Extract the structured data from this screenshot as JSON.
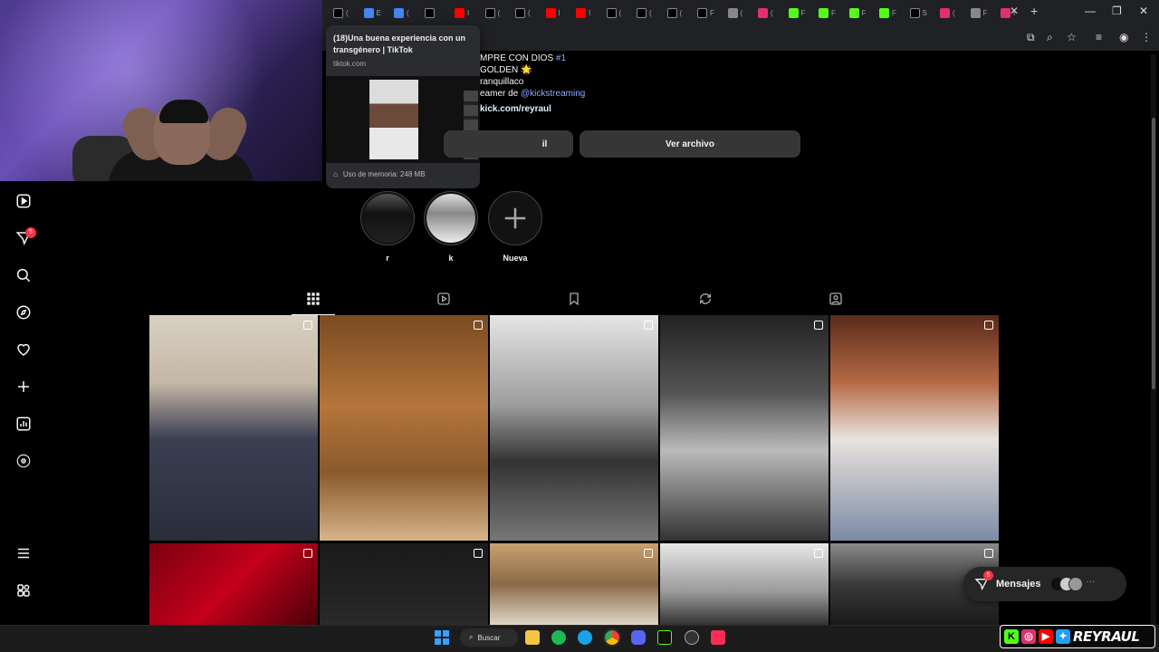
{
  "browser": {
    "tabs": [
      {
        "icon": "tiktok-icon",
        "color": "#000000",
        "label": "("
      },
      {
        "icon": "chrome-icon",
        "color": "#4285f4",
        "label": "E"
      },
      {
        "icon": "chrome-icon",
        "color": "#4285f4",
        "label": "("
      },
      {
        "icon": "tiktok-icon",
        "color": "#000000",
        "label": ""
      },
      {
        "icon": "youtube-icon",
        "color": "#ff0000",
        "label": "I"
      },
      {
        "icon": "tiktok-icon",
        "color": "#000000",
        "label": "("
      },
      {
        "icon": "tiktok-icon",
        "color": "#000000",
        "label": "("
      },
      {
        "icon": "youtube-icon",
        "color": "#ff0000",
        "label": "I"
      },
      {
        "icon": "youtube-icon",
        "color": "#ff0000",
        "label": "I"
      },
      {
        "icon": "tiktok-icon",
        "color": "#000000",
        "label": "("
      },
      {
        "icon": "tiktok-icon",
        "color": "#000000",
        "label": "("
      },
      {
        "icon": "tiktok-icon",
        "color": "#000000",
        "label": "("
      },
      {
        "icon": "tiktok-icon",
        "color": "#000000",
        "label": "F"
      },
      {
        "icon": "mail-icon",
        "color": "#888888",
        "label": "("
      },
      {
        "icon": "instagram-icon",
        "color": "#e1306c",
        "label": "("
      },
      {
        "icon": "kick-icon",
        "color": "#53fc18",
        "label": "F"
      },
      {
        "icon": "kick-icon",
        "color": "#53fc18",
        "label": "F"
      },
      {
        "icon": "kick-icon",
        "color": "#53fc18",
        "label": "F"
      },
      {
        "icon": "kick-icon",
        "color": "#53fc18",
        "label": "F"
      },
      {
        "icon": "tiktok-icon",
        "color": "#000000",
        "label": "S"
      },
      {
        "icon": "instagram-icon",
        "color": "#e1306c",
        "label": "("
      },
      {
        "icon": "chrome-icon",
        "color": "#888888",
        "label": "F"
      },
      {
        "icon": "instagram-icon",
        "color": "#e1306c",
        "label": "I"
      }
    ],
    "hover_card": {
      "title": "(18)Una buena experiencia con un transgénero | TikTok",
      "domain": "tiktok.com",
      "memory": "Uso de memoria: 248 MB"
    }
  },
  "profile": {
    "bio_lines": [
      {
        "text": "MPRE CON DIOS ",
        "hash": "#1"
      },
      {
        "text": "GOLDEN 🌟",
        "hash": ""
      },
      {
        "text": "ranquillaco",
        "hash": ""
      }
    ],
    "streamer_prefix": "eamer de ",
    "streamer_mention": "@kickstreaming",
    "link": "kick.com/reyraul",
    "edit_label_fragment": "il",
    "archive_label": "Ver archivo"
  },
  "highlights": [
    {
      "label": "r"
    },
    {
      "label": "k"
    },
    {
      "label": "Nueva"
    }
  ],
  "posts": [
    {
      "tone": "linear-gradient(180deg,#d9d0c3 0%,#c4b7a6 30%,#3b3f52 55%,#2a2d3a 100%)"
    },
    {
      "tone": "linear-gradient(180deg,#7a4b22 0%,#b5753b 40%,#8a5a2c 70%,#d6b48a 100%)"
    },
    {
      "tone": "linear-gradient(180deg,#e6e6e6 0%,#9c9c9c 40%,#333 65%,#777 100%)"
    },
    {
      "tone": "linear-gradient(180deg,#222 0%,#555 35%,#bbb 60%,#333 100%)"
    },
    {
      "tone": "linear-gradient(180deg,#5a2a1a 0%,#b66a46 30%,#e8e3de 55%,#7d8aa5 100%)"
    },
    {
      "tone": "linear-gradient(135deg,#7a0010 0%,#c4001a 50%,#4a0008 100%)"
    },
    {
      "tone": "linear-gradient(180deg,#1a1a1a 0%,#222 60%,#2a2a2a 100%)"
    },
    {
      "tone": "linear-gradient(180deg,#c9a170 0%,#8a6a48 50%,#e0d6c8 100%)"
    },
    {
      "tone": "linear-gradient(180deg,#e8e8e8 0%,#999 60%,#333 100%)"
    },
    {
      "tone": "linear-gradient(180deg,#8a8a8a 0%,#3a3a3a 50%,#1a1a1a 100%)"
    }
  ],
  "messages": {
    "label": "Mensajes",
    "badge": "5"
  },
  "sidebar": {
    "notif_badge": "5"
  },
  "taskbar": {
    "search_label": "Buscar"
  },
  "stream_overlay": {
    "name": "REYRAUL"
  }
}
